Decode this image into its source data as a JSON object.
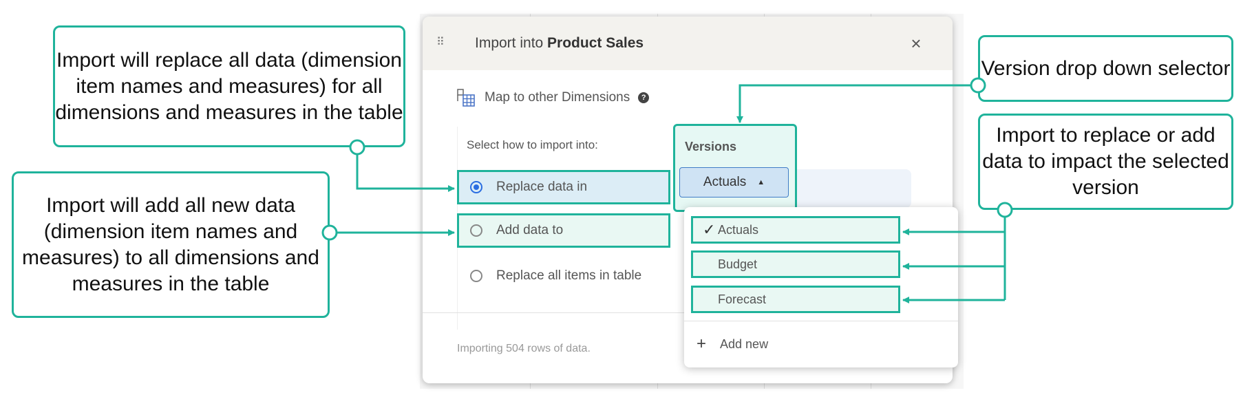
{
  "modal": {
    "title_prefix": "Import into ",
    "title_bold": "Product Sales",
    "close_glyph": "×",
    "drag_glyph": "⠿",
    "map_label": "Map to other Dimensions",
    "help_glyph": "?",
    "select_how": "Select how to import into:",
    "options": [
      {
        "label": "Replace data in",
        "checked": true
      },
      {
        "label": "Add data to",
        "checked": false
      },
      {
        "label": "Replace all items in table",
        "checked": false
      }
    ],
    "versions_label": "Versions",
    "versions_selected": "Actuals",
    "footer": "Importing 504 rows of data."
  },
  "dropdown": {
    "items": [
      {
        "label": "Actuals",
        "selected": true
      },
      {
        "label": "Budget",
        "selected": false
      },
      {
        "label": "Forecast",
        "selected": false
      }
    ],
    "check_glyph": "✓",
    "add_new": "Add new",
    "plus_glyph": "+"
  },
  "callouts": {
    "replace_all": "Import will replace all data (dimension item names and measures) for all dimensions and measures in the table",
    "add_all": "Import will add all new data (dimension item names and measures) to all dimensions and measures in the table",
    "version_selector": "Version drop down selector",
    "impact_version": "Import to replace or add data to impact the selected version"
  },
  "colors": {
    "accent_teal": "#1fb39b",
    "radio_blue": "#2a6de1"
  }
}
